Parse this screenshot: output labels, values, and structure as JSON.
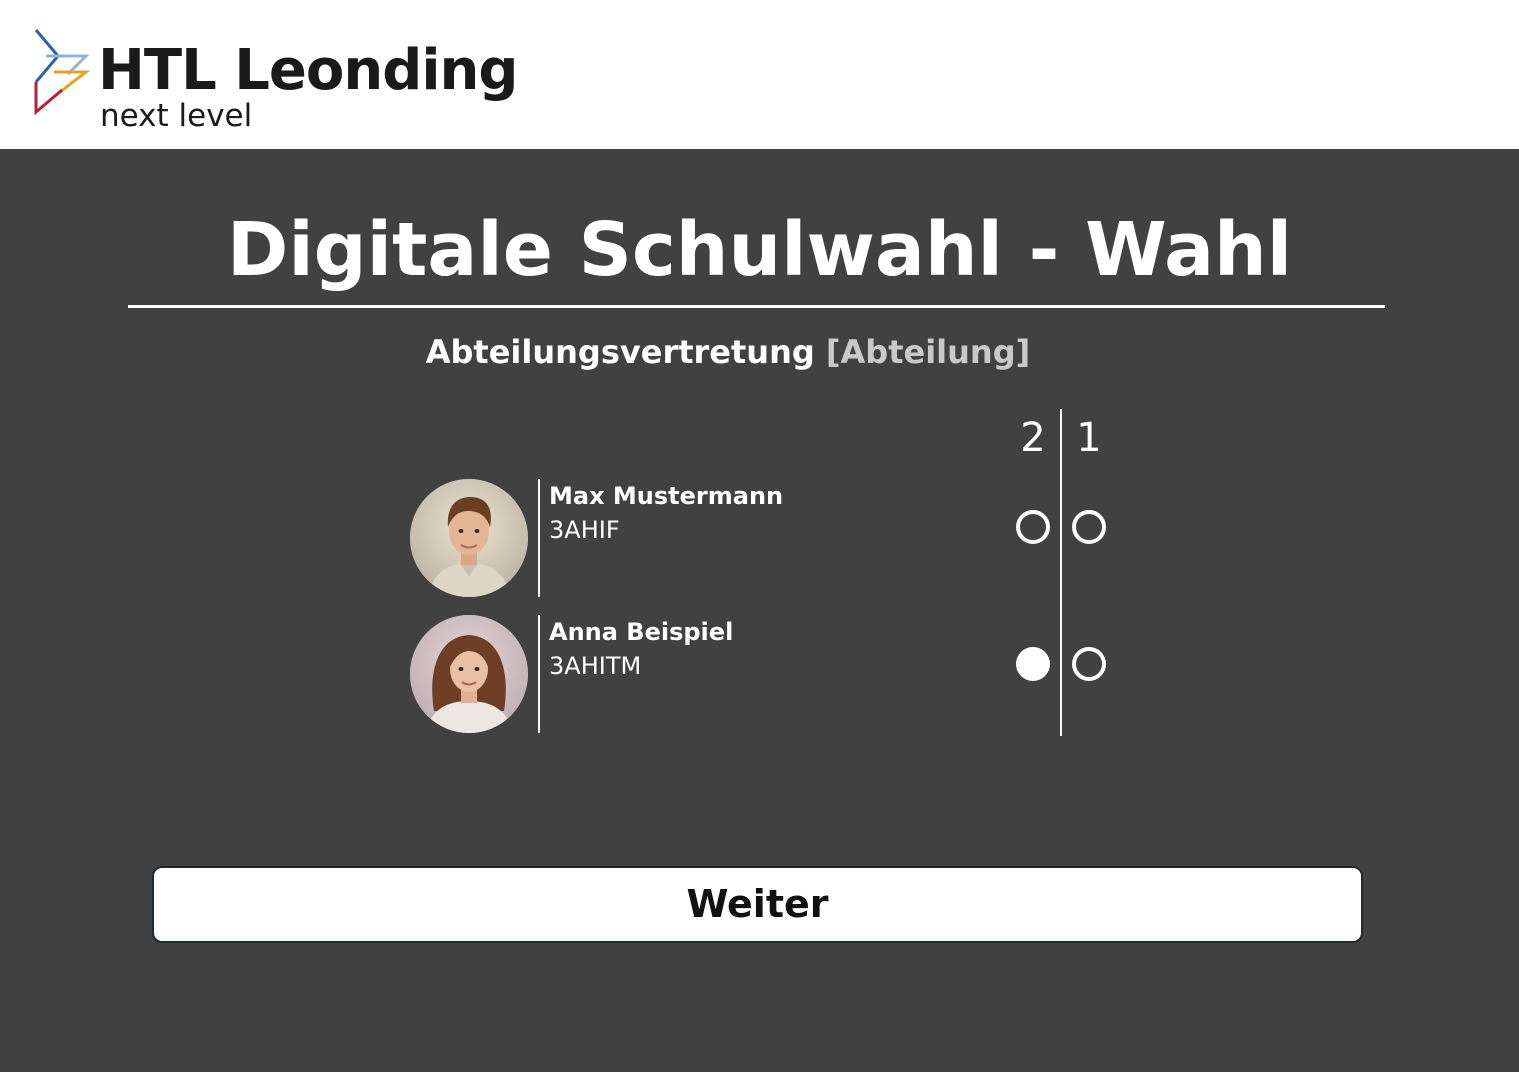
{
  "header": {
    "logo_title": "HTL Leonding",
    "logo_subtitle": "next level",
    "logo_icon": "htl-chevron-logo-icon"
  },
  "page": {
    "title": "Digitale Schulwahl - Wahl"
  },
  "section": {
    "name": "Abteilungsvertretung",
    "placeholder": "[Abteilung]"
  },
  "ranking": {
    "columns": [
      "2",
      "1"
    ]
  },
  "candidates": [
    {
      "name": "Max Mustermann",
      "class": "3AHIF",
      "avatar_icon": "male-student-avatar",
      "votes": {
        "rank_2": false,
        "rank_1": false
      }
    },
    {
      "name": "Anna Beispiel",
      "class": "3AHITM",
      "avatar_icon": "female-student-avatar",
      "votes": {
        "rank_2": true,
        "rank_1": false
      }
    }
  ],
  "actions": {
    "next_label": "Weiter"
  },
  "colors": {
    "background": "#414141",
    "header_background": "#ffffff",
    "text": "#ffffff",
    "placeholder_text": "#c9c9c9",
    "logo_blue": "#2f5fa8",
    "logo_red": "#b3203a",
    "logo_orange": "#e8a22a"
  }
}
